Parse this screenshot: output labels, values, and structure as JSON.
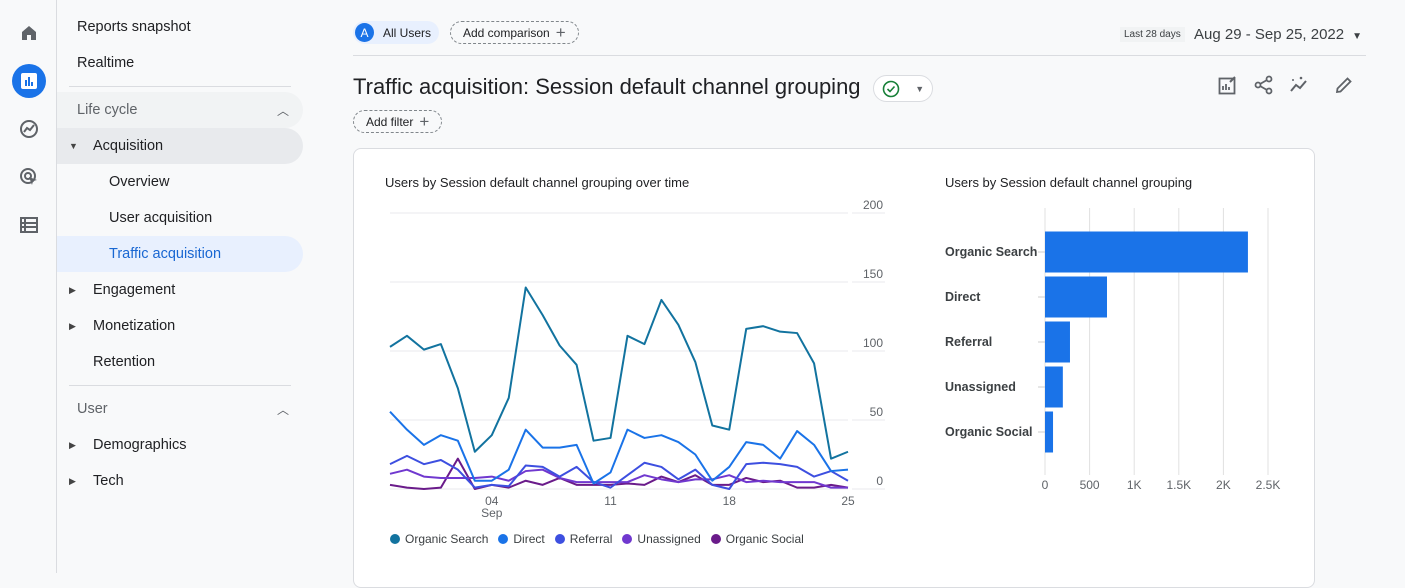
{
  "rail": [
    {
      "icon": "home-icon"
    },
    {
      "icon": "reports-icon",
      "active": true
    },
    {
      "icon": "explore-icon"
    },
    {
      "icon": "advertising-icon"
    },
    {
      "icon": "configure-icon"
    }
  ],
  "sidebar": {
    "reports_snapshot": "Reports snapshot",
    "realtime": "Realtime",
    "lifecycle": "Life cycle",
    "acquisition": "Acquisition",
    "overview": "Overview",
    "user_acquisition": "User acquisition",
    "traffic_acquisition": "Traffic acquisition",
    "engagement": "Engagement",
    "monetization": "Monetization",
    "retention": "Retention",
    "user": "User",
    "demographics": "Demographics",
    "tech": "Tech"
  },
  "header": {
    "segment_avatar": "A",
    "segment": "All Users",
    "add_comparison": "Add comparison",
    "date_preset": "Last 28 days",
    "date_range": "Aug 29 - Sep 25, 2022",
    "title": "Traffic acquisition: Session default channel grouping",
    "add_filter": "Add filter"
  },
  "colors": {
    "accent": "#1a73e8",
    "organic_search": "#12739f",
    "direct": "#1a73e8",
    "referral": "#3d4fe0",
    "unassigned": "#7038cf",
    "organic_social": "#6a1b8a"
  },
  "chart_data": [
    {
      "type": "line",
      "title": "Users by Session default channel grouping over time",
      "x_start": "2022-08-29",
      "x_end": "2022-09-25",
      "x_ticks": [
        "04",
        "11",
        "18",
        "25"
      ],
      "x_tick_sublabel": "Sep",
      "ylim": [
        0,
        200
      ],
      "y_ticks": [
        "0",
        "50",
        "100",
        "150",
        "200"
      ],
      "grid": true,
      "legend": "bottom",
      "series": [
        {
          "name": "Organic Search",
          "color": "#12739f",
          "values": [
            103,
            111,
            101,
            105,
            73,
            27,
            39,
            66,
            146,
            126,
            104,
            90,
            35,
            37,
            111,
            105,
            137,
            119,
            92,
            46,
            43,
            116,
            118,
            114,
            113,
            91,
            22,
            27
          ]
        },
        {
          "name": "Direct",
          "color": "#1a73e8",
          "values": [
            56,
            43,
            32,
            39,
            35,
            6,
            6,
            14,
            43,
            30,
            30,
            32,
            4,
            12,
            43,
            37,
            39,
            34,
            25,
            6,
            16,
            34,
            32,
            22,
            42,
            32,
            13,
            14
          ]
        },
        {
          "name": "Referral",
          "color": "#3d4fe0",
          "values": [
            18,
            24,
            18,
            21,
            14,
            1,
            3,
            2,
            17,
            16,
            9,
            16,
            5,
            1,
            10,
            19,
            16,
            7,
            14,
            3,
            0,
            18,
            19,
            18,
            16,
            9,
            13,
            6
          ]
        },
        {
          "name": "Unassigned",
          "color": "#7038cf",
          "values": [
            11,
            14,
            9,
            8,
            8,
            8,
            9,
            6,
            13,
            14,
            8,
            5,
            5,
            5,
            5,
            10,
            7,
            5,
            7,
            7,
            10,
            5,
            6,
            5,
            5,
            5,
            1,
            1
          ]
        },
        {
          "name": "Organic Social",
          "color": "#6a1b8a",
          "values": [
            3,
            1,
            0,
            1,
            22,
            0,
            3,
            1,
            6,
            3,
            8,
            3,
            3,
            3,
            4,
            3,
            9,
            5,
            10,
            3,
            3,
            8,
            5,
            6,
            1,
            1,
            3,
            1
          ]
        }
      ]
    },
    {
      "type": "bar",
      "orientation": "horizontal",
      "title": "Users by Session default channel grouping",
      "categories": [
        "Organic Search",
        "Direct",
        "Referral",
        "Unassigned",
        "Organic Social"
      ],
      "values": [
        2275,
        695,
        280,
        200,
        90
      ],
      "xlim": [
        0,
        2500
      ],
      "x_ticks": [
        "0",
        "500",
        "1K",
        "1.5K",
        "2K",
        "2.5K"
      ],
      "grid": true,
      "color": "#1a73e8"
    }
  ]
}
